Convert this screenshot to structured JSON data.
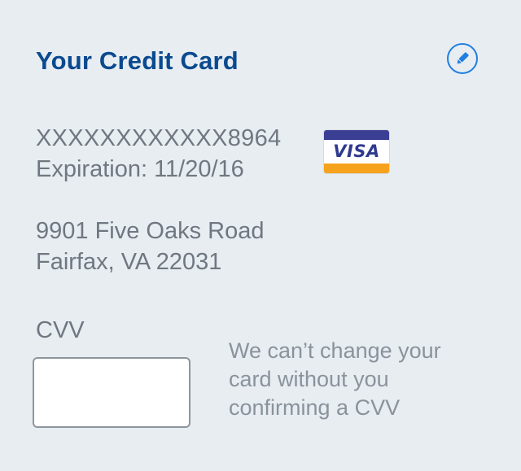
{
  "header": {
    "title": "Your Credit Card",
    "edit_icon": "pencil-icon"
  },
  "card": {
    "number": "XXXXXXXXXXXX8964",
    "expiration": "Expiration: 11/20/16",
    "brand": "VISA",
    "brand_colors": {
      "top_band": "#3a3f94",
      "bottom_band": "#f6a21c",
      "text": "#2f3a8f"
    }
  },
  "address": {
    "line1": "9901 Five Oaks Road",
    "line2": "Fairfax, VA 22031"
  },
  "cvv": {
    "label": "CVV",
    "value": "",
    "help_text": "We can’t change your card without you confirming a CVV"
  },
  "colors": {
    "background": "#e8edf2",
    "title": "#0a4a8f",
    "accent": "#1f7fe0",
    "text": "#6f7780"
  }
}
